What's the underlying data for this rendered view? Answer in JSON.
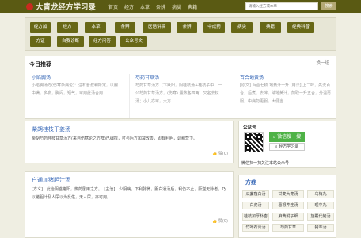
{
  "site": {
    "title": "大青龙经方学习录"
  },
  "nav": [
    "首页",
    "经方",
    "本草",
    "条辨",
    "病类",
    "典籍"
  ],
  "search": {
    "placeholder": "请输入经方或本草",
    "button": "搜索"
  },
  "categories": [
    "经方加",
    "经方",
    "本草",
    "条辨",
    "医话讲稿",
    "条辨",
    "中成药",
    "病类",
    "典籍",
    "经典科普",
    "方证",
    "自我诊断",
    "经方问答",
    "公众号文"
  ],
  "today": {
    "title": "今日推荐",
    "more": "换一组",
    "columns": [
      {
        "title": "小陷胸汤",
        "text": "小陷胸汤方(伤寒杂病论)：注有晋叔和所定，以胸中满，多痰，胸闷，短气，可用此汤合用"
      },
      {
        "title": "芍药甘草汤",
        "text": "芍药甘草汤方（下跃阳，阴桂枝汤+桂枝子中，一公芍药甘草汤方，(伤寒) 量数各四两，又名去杖汤；小儿亦可，大方"
      },
      {
        "title": "百合地黄汤",
        "text": "[原文] 百合七枚 地黄汁一升 [用法] 上二味，先洗百合，后煮。去滓，纳地黄汁，煎取一升五合，分温再服，中病勿更服，大便当"
      }
    ]
  },
  "recommend": [
    {
      "title": "柴胡桂枝干姜汤",
      "body": "柴胡芍药桂枝甘草汤方(来自伤寒论之方群)已编撰，可与后方加减改善，即有利胆，调和营卫。",
      "likes": "赞(0)"
    },
    {
      "title": "白通加猪胆汁汤",
      "body": "[方义]　此治阴盛格阳，热药居用之方。　[主治]　少阴病，下利脉微，服白通汤后，利仍不止，厥逆无脉者，乃以猪胆汁及人尿以为反佐，无人尿，亦可用。",
      "likes": "赞(0)"
    }
  ],
  "wechat": {
    "title": "公众号",
    "button": "微信搜一搜",
    "name": "经方学习录",
    "caption": "微信扫一扫关注本站公众号"
  },
  "formulas": {
    "title": "方症",
    "items": [
      "瓜蒌薤白汤",
      "甘麦大枣汤",
      "乌梅丸",
      "白虎汤",
      "葛根芩连汤",
      "理中丸",
      "桂枝加厚朴杏",
      "麻黄附子细",
      "旋覆代赭汤",
      "竹叶石膏汤",
      "芍药甘草",
      "猪苓汤"
    ]
  },
  "colors": {
    "brand": "#5a5a13",
    "accent": "#676716",
    "link": "#3a6ab8",
    "wechat": "#4eb246"
  }
}
